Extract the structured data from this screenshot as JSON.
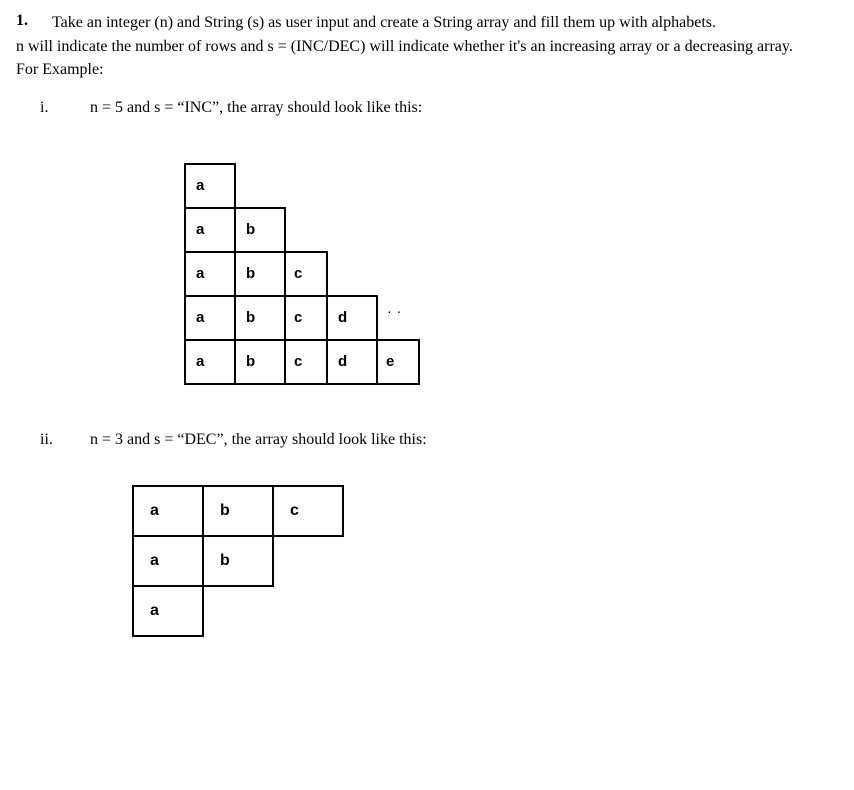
{
  "question": {
    "number": "1.",
    "line1": "Take an integer (n) and String (s) as user input and create a String array and fill them up with alphabets.",
    "line2": "n will indicate the number of rows and s = (INC/DEC) will indicate whether it's an increasing array or a decreasing array.",
    "line3": "For Example:"
  },
  "examples": [
    {
      "roman": "i.",
      "text": "n = 5 and s = “INC”, the array should look like this:",
      "grid": {
        "type": "inc",
        "rows": [
          [
            "a"
          ],
          [
            "a",
            "b"
          ],
          [
            "a",
            "b",
            "c"
          ],
          [
            "a",
            "b",
            "c",
            "d"
          ],
          [
            "a",
            "b",
            "c",
            "d",
            "e"
          ]
        ]
      }
    },
    {
      "roman": "ii.",
      "text": "n = 3 and s = “DEC”, the array should look like this:",
      "grid": {
        "type": "dec",
        "rows": [
          [
            "a",
            "b",
            "c"
          ],
          [
            "a",
            "b"
          ],
          [
            "a"
          ]
        ]
      }
    }
  ],
  "dots": ". ."
}
